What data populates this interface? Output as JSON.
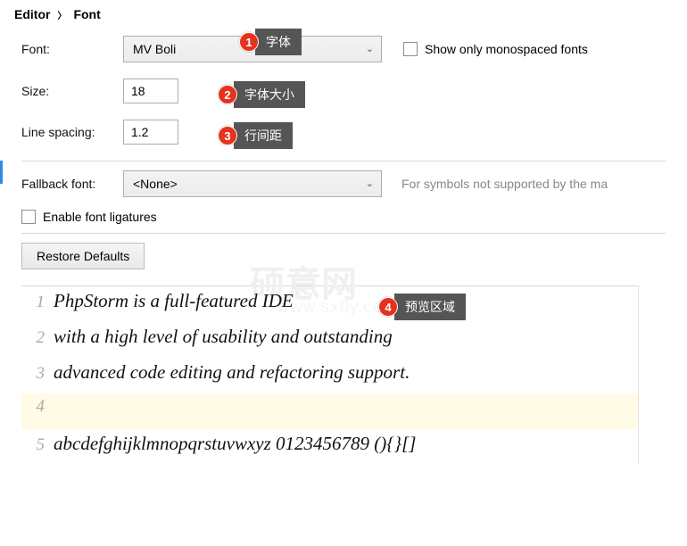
{
  "breadcrumb": {
    "parent": "Editor",
    "child": "Font"
  },
  "labels": {
    "font": "Font:",
    "size": "Size:",
    "lineSpacing": "Line spacing:",
    "fallback": "Fallback font:"
  },
  "values": {
    "font": "MV Boli",
    "size": "18",
    "lineSpacing": "1.2",
    "fallback": "<None>"
  },
  "check": {
    "monospaceOnly": "Show only monospaced fonts",
    "ligatures": "Enable font ligatures"
  },
  "hint": {
    "fallback": "For symbols not supported by the ma"
  },
  "buttons": {
    "restore": "Restore Defaults"
  },
  "callouts": {
    "c1": {
      "num": "1",
      "label": "字体"
    },
    "c2": {
      "num": "2",
      "label": "字体大小"
    },
    "c3": {
      "num": "3",
      "label": "行间距"
    },
    "c4": {
      "num": "4",
      "label": "预览区域"
    }
  },
  "preview": {
    "lines": {
      "l1": "PhpStorm is a full-featured IDE",
      "l2": "with a high level of usability and outstanding",
      "l3": "advanced code editing and refactoring support.",
      "l4": "",
      "l5": "abcdefghijklmnopqrstuvwxyz 0123456789 (){}[]"
    },
    "nums": {
      "n1": "1",
      "n2": "2",
      "n3": "3",
      "n4": "4",
      "n5": "5"
    }
  }
}
